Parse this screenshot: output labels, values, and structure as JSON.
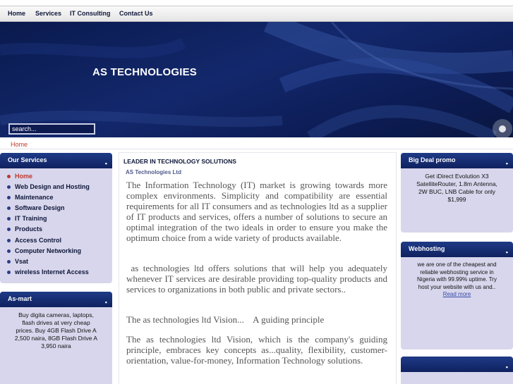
{
  "nav": {
    "items": [
      {
        "label": "Home"
      },
      {
        "label": "Services"
      },
      {
        "label": "IT Consulting"
      },
      {
        "label": "Contact Us"
      }
    ]
  },
  "banner": {
    "title": "AS TECHNOLOGIES",
    "search_placeholder": "search..."
  },
  "breadcrumb": {
    "label": "Home"
  },
  "our_services": {
    "title": "Our Services",
    "items": [
      {
        "label": "Home",
        "active": true
      },
      {
        "label": "Web Design and Hosting"
      },
      {
        "label": "Maintenance"
      },
      {
        "label": "Software Design"
      },
      {
        "label": "IT Training"
      },
      {
        "label": "Products"
      },
      {
        "label": "Access Control"
      },
      {
        "label": "Computer Networking"
      },
      {
        "label": "Vsat"
      },
      {
        "label": "wireless Internet Access"
      }
    ]
  },
  "as_mart": {
    "title": "As-mart",
    "text_lines": [
      "Buy digita cameras, laptops,",
      "flash drives at very cheap",
      "prices. Buy 4GB Flash Drive A",
      "2,500 naira, 8GB Flash Drive A",
      "3,950 naira"
    ]
  },
  "main": {
    "heading": "LEADER IN TECHNOLOGY SOLUTIONS",
    "subheading": "AS Technologies Ltd",
    "paragraphs": [
      "The Information Technology (IT) market is growing towards more complex environments. Simplicity and compatibility are essential requirements for all IT consumers and as technologies ltd as a supplier of IT products and services, offers a number of solutions to secure an optimal integration of the two ideals in order to ensure you make the optimum choice from a wide variety of products available.",
      " as technologies ltd offers solutions that will help you adequately whenever IT services are desirable providing top-quality products and services to organizations in both public and private sectors..",
      "The as technologies ltd Vision...    A guiding principle",
      "The as technologies ltd Vision, which is the company's guiding principle, embraces key concepts as...quality, flexibility, customer-orientation, value-for-money, Information Technology solutions."
    ]
  },
  "big_deal": {
    "title": "Big Deal promo",
    "text_lines": [
      "Get iDirect Evolution X3",
      "SatelliteRouter, 1.8m Antenna,",
      "2W BUC, LNB Cable for only",
      "$1,999"
    ]
  },
  "webhosting": {
    "title": "Webhosting",
    "text_lines": [
      "we are one of the cheapest and",
      "reliable webhosting service in",
      "Nigeria with 99.99% uptime. Try",
      "host your website with us and.."
    ],
    "link": "Read more"
  },
  "colors": {
    "banner": "#0f2160",
    "box_bg": "#d8d6ec",
    "accent_red": "#c0392b"
  }
}
